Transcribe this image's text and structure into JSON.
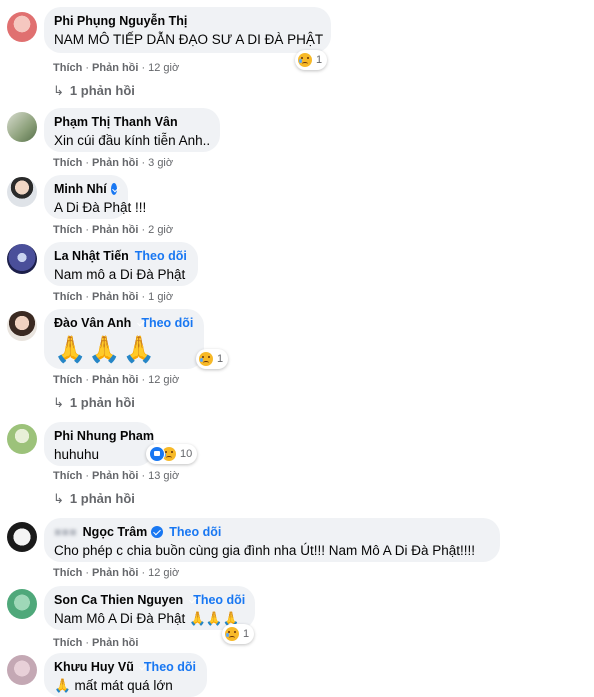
{
  "comments": [
    {
      "name": "Phi Phụng Nguyễn Thị",
      "text": "NAM MÔ TIẾP DẪN ĐẠO SƯ A DI ĐÀ PHẬT",
      "action_like": "Thích",
      "action_reply": "Phản hồi",
      "time": "12 giờ",
      "reactions": "1",
      "replies": "1 phản hồi"
    },
    {
      "name": "Phạm Thị Thanh Vân",
      "text": "Xin cúi đầu kính tiễn Anh..",
      "action_like": "Thích",
      "action_reply": "Phản hồi",
      "time": "3 giờ"
    },
    {
      "name": "Minh Nhí",
      "text": "A Di Đà Phật !!!",
      "action_like": "Thích",
      "action_reply": "Phản hồi",
      "time": "2 giờ"
    },
    {
      "name": "La Nhật Tiến",
      "follow": "Theo dõi",
      "text": "Nam mô a Di Đà Phật",
      "action_like": "Thích",
      "action_reply": "Phản hồi",
      "time": "1 giờ"
    },
    {
      "name": "Đào Vân Anh",
      "follow": "Theo dõi",
      "text": "🙏🙏🙏",
      "action_like": "Thích",
      "action_reply": "Phản hồi",
      "time": "12 giờ",
      "reactions": "1",
      "replies": "1 phản hồi"
    },
    {
      "name": "Phi Nhung Pham",
      "text": "huhuhu",
      "action_like": "Thích",
      "action_reply": "Phản hồi",
      "time": "13 giờ",
      "reactions": "10",
      "replies": "1 phản hồi"
    },
    {
      "name": "Ngọc Trâm",
      "follow": "Theo dõi",
      "text": "Cho phép c chia buồn cùng gia đình nha Út!!! Nam Mô A Di Đà Phật!!!!",
      "action_like": "Thích",
      "action_reply": "Phản hồi",
      "time": "12 giờ"
    },
    {
      "name": "Son Ca Thien Nguyen",
      "follow": "Theo dõi",
      "text": "Nam Mô A Di Đà Phật 🙏🙏🙏",
      "action_like": "Thích",
      "action_reply": "Phản hồi",
      "reactions": "1"
    },
    {
      "name": "Khưu Huy Vũ",
      "follow": "Theo dõi",
      "text": "🙏 mất mát quá lớn"
    }
  ],
  "colors": {
    "bubble": "#f0f2f5",
    "link": "#1877f2",
    "meta": "#65676b"
  },
  "icons": {
    "reply_arrow": "reply-arrow-icon",
    "verified": "verified-badge-icon",
    "sad": "sad-reaction-icon",
    "like": "like-reaction-icon"
  }
}
